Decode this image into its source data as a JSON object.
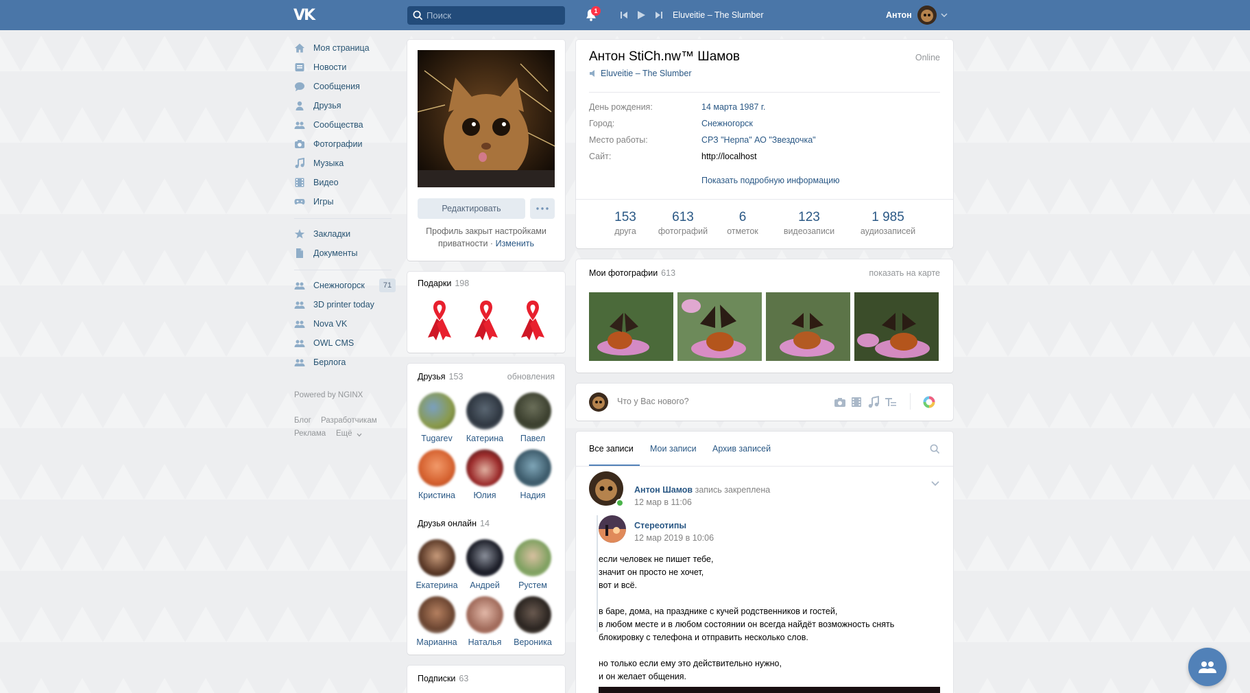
{
  "header": {
    "logo_text": "VK",
    "search_placeholder": "Поиск",
    "notifications_count": "1",
    "now_playing": "Eluveitie – The Slumber",
    "user_name": "Антон"
  },
  "sidebar": {
    "items": [
      {
        "label": "Моя страница",
        "icon": "home-icon"
      },
      {
        "label": "Новости",
        "icon": "news-icon"
      },
      {
        "label": "Сообщения",
        "icon": "messages-icon"
      },
      {
        "label": "Друзья",
        "icon": "friend-icon"
      },
      {
        "label": "Сообщества",
        "icon": "groups-icon"
      },
      {
        "label": "Фотографии",
        "icon": "camera-icon"
      },
      {
        "label": "Музыка",
        "icon": "music-icon"
      },
      {
        "label": "Видео",
        "icon": "video-icon"
      },
      {
        "label": "Игры",
        "icon": "gamepad-icon"
      }
    ],
    "extra_items": [
      {
        "label": "Закладки",
        "icon": "star-icon"
      },
      {
        "label": "Документы",
        "icon": "document-icon"
      }
    ],
    "groups": [
      {
        "label": "Снежногорск",
        "count": "71"
      },
      {
        "label": "3D printer today"
      },
      {
        "label": "Nova VK"
      },
      {
        "label": "OWL CMS"
      },
      {
        "label": "Берлога"
      }
    ],
    "powered_by": "Powered by NGINX",
    "footer_links": [
      "Блог",
      "Разработчикам",
      "Реклама",
      "Ещё"
    ]
  },
  "profile_card": {
    "edit_label": "Редактировать",
    "privacy_note": "Профиль закрыт настройками приватности",
    "privacy_change": "Изменить",
    "separator": "·"
  },
  "gifts": {
    "title": "Подарки",
    "count": "198"
  },
  "friends": {
    "title": "Друзья",
    "count": "153",
    "updates_label": "обновления",
    "items": [
      "Tugarev",
      "Катерина",
      "Павел",
      "Кристина",
      "Юлия",
      "Надия"
    ]
  },
  "friends_online": {
    "title": "Друзья онлайн",
    "count": "14",
    "items": [
      "Екатерина",
      "Андрей",
      "Рустем",
      "Марианна",
      "Наталья",
      "Вероника"
    ]
  },
  "subscriptions": {
    "title": "Подписки",
    "count": "63"
  },
  "info": {
    "name": "Антон StiCh.nw™ Шамов",
    "online": "Online",
    "status_track": "Eluveitie – The Slumber",
    "rows": [
      {
        "label": "День рождения:",
        "value": "14 марта 1987 г."
      },
      {
        "label": "Город:",
        "value": "Снежногорск"
      },
      {
        "label": "Место работы:",
        "value": "СРЗ \"Нерпа\" АО \"Звездочка\""
      },
      {
        "label": "Сайт:",
        "value": "http://localhost"
      }
    ],
    "show_more": "Показать подробную информацию",
    "counters": [
      {
        "num": "153",
        "label": "друга"
      },
      {
        "num": "613",
        "label": "фотографий"
      },
      {
        "num": "6",
        "label": "отметок"
      },
      {
        "num": "123",
        "label": "видеозаписи"
      },
      {
        "num": "1 985",
        "label": "аудиозаписей"
      }
    ]
  },
  "photos": {
    "title": "Мои фотографии",
    "count": "613",
    "map_link": "показать на карте"
  },
  "composer": {
    "placeholder": "Что у Вас нового?"
  },
  "wall": {
    "tabs": [
      "Все записи",
      "Мои записи",
      "Архив записей"
    ],
    "post": {
      "author": "Антон Шамов",
      "pinned": "запись закреплена",
      "date": "12 мар в 11:06",
      "repost_source": "Стереотипы",
      "repost_date": "12 мар 2019 в 10:06",
      "text": "если человек не пишет тебе,\nзначит он просто не хочет,\nвот и всё.\n\nв баре, дома, на празднике с кучей родственников и гостей,\nв любом месте и в любом состоянии он всегда найдёт возможность снять\nблокировку с телефона и отправить несколько слов.\n\nно только если ему это действительно нужно,\nи он желает общения."
    }
  },
  "colors": {
    "header_bg": "#4a76a8",
    "link": "#2a5885",
    "accent": "#5181b8",
    "page_bg": "#edeef0"
  }
}
